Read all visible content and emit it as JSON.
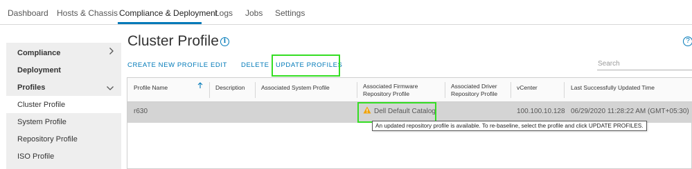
{
  "top_nav": {
    "tabs": [
      {
        "label": "Dashboard"
      },
      {
        "label": "Hosts & Chassis"
      },
      {
        "label": "Compliance & Deployment"
      },
      {
        "label": "Logs"
      },
      {
        "label": "Jobs"
      },
      {
        "label": "Settings"
      }
    ],
    "active_tab": "Compliance & Deployment"
  },
  "sidebar": {
    "items": [
      {
        "label": "Compliance",
        "kind": "group",
        "chevron": "chevron-right-icon"
      },
      {
        "label": "Deployment",
        "kind": "group"
      },
      {
        "label": "Profiles",
        "kind": "group",
        "chevron": "chevron-down-icon"
      },
      {
        "label": "Cluster Profile",
        "kind": "item",
        "selected": true
      },
      {
        "label": "System Profile",
        "kind": "item"
      },
      {
        "label": "Repository Profile",
        "kind": "item"
      },
      {
        "label": "ISO Profile",
        "kind": "item"
      }
    ]
  },
  "main": {
    "title": "Cluster Profile",
    "info_icon_glyph": "i",
    "help_icon_glyph": "?",
    "actions": {
      "create": "CREATE NEW PROFILE",
      "edit": "EDIT",
      "delete": "DELETE",
      "update": "UPDATE PROFILES"
    },
    "search": {
      "placeholder": "Search",
      "value": ""
    },
    "table": {
      "columns": [
        {
          "label": "Profile Name",
          "sorted": "ascending"
        },
        {
          "label": "Description"
        },
        {
          "label": "Associated System Profile"
        },
        {
          "label": "Associated Firmware\nRepository Profile"
        },
        {
          "label": "Associated Driver\nRepository Profile"
        },
        {
          "label": "vCenter"
        },
        {
          "label": "Last Successfully Updated Time"
        }
      ],
      "rows": [
        {
          "profile_name": "r630",
          "description": "",
          "system_profile": "",
          "firmware_repository": "Dell Default Catalog",
          "driver_repository": "",
          "vcenter": "100.100.10.128",
          "last_updated": "06/29/2020 11:28:22 AM (GMT+05:30)",
          "selected": true,
          "warning_icon": "warning-triangle-icon"
        }
      ]
    },
    "tooltip": "An updated repository profile is available. To re-baseline, select the profile and click UPDATE PROFILES."
  },
  "colors": {
    "accent": "#0079b8",
    "highlight": "#33dd22",
    "warning": "#f0a30a",
    "selected_row": "#d4d4d4",
    "sidebar_bg": "#eeeeee"
  }
}
